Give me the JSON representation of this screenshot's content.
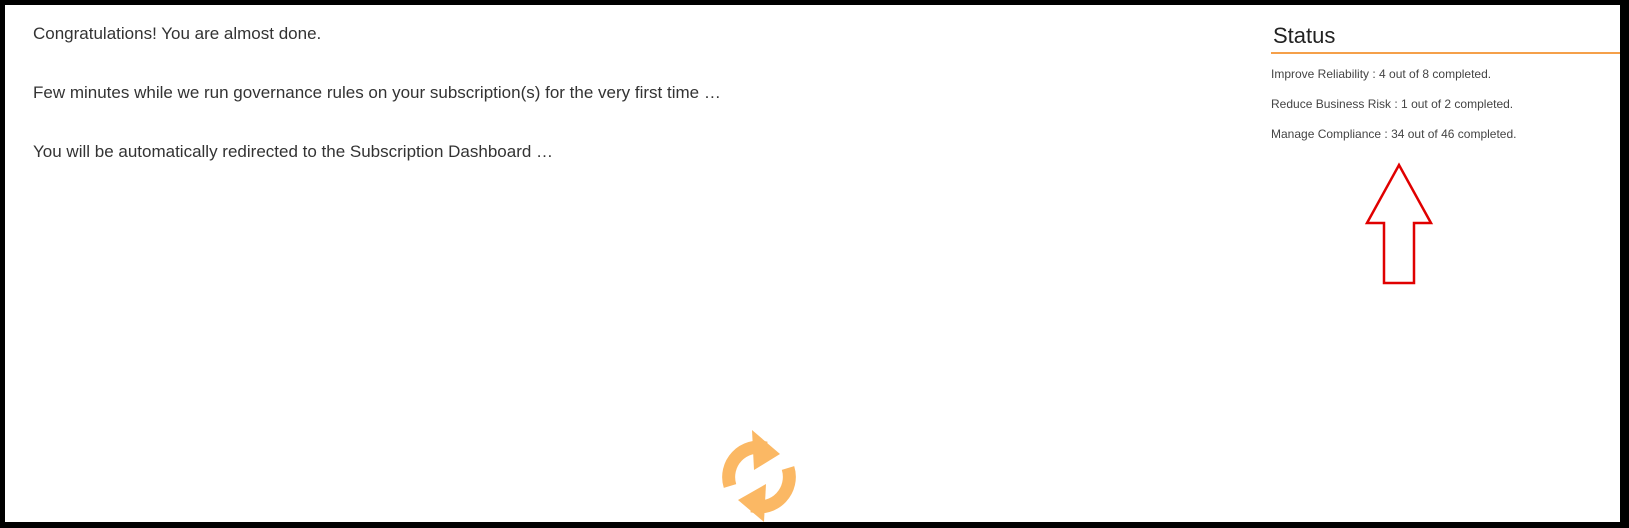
{
  "messages": {
    "congrats": "Congratulations! You are almost done.",
    "running": "Few minutes while we run governance rules on your subscription(s) for the very first time …",
    "redirect": "You will be automatically redirected to the Subscription Dashboard …"
  },
  "status": {
    "title": "Status",
    "items": [
      "Improve Reliability : 4 out of 8 completed.",
      "Reduce Business Risk : 1 out of 2 completed.",
      "Manage Compliance : 34 out of 46 completed."
    ]
  },
  "colors": {
    "accent": "#f5a04a",
    "spinner": "#fbb864",
    "annotation_arrow": "#e00000"
  },
  "icons": {
    "spinner": "refresh-icon",
    "annotation": "up-arrow-icon"
  }
}
